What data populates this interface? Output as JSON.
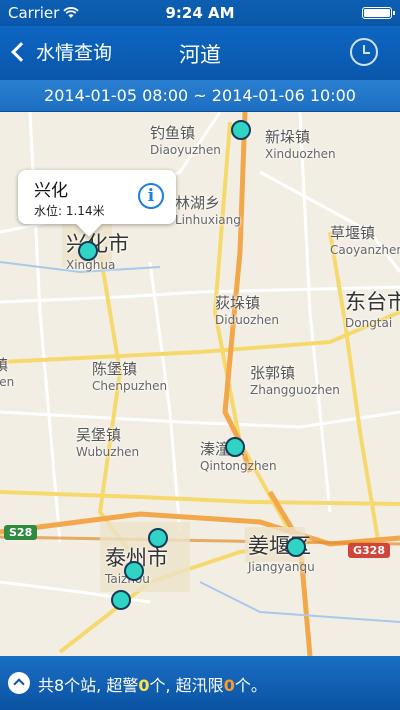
{
  "status_bar": {
    "carrier": "Carrier",
    "time": "9:24 AM",
    "icon_wifi": "wifi-icon",
    "icon_battery": "battery-icon"
  },
  "nav": {
    "back_label": "水情查询",
    "title": "河道",
    "history_icon": "clock-icon"
  },
  "date_range": "2014-01-05 08:00 ~ 2014-01-06 10:00",
  "callout": {
    "name": "兴化",
    "level": "水位: 1.14米",
    "info_icon": "info-icon"
  },
  "places": [
    {
      "cn": "钓鱼镇",
      "py": "Diaoyuzhen"
    },
    {
      "cn": "新垛镇",
      "py": "Xinduozhen"
    },
    {
      "cn": "林湖乡",
      "py": "Linhuxiang"
    },
    {
      "cn": "草堰镇",
      "py": "Caoyanzhen"
    },
    {
      "cn": "兴化市",
      "py": "Xinghua"
    },
    {
      "cn": "荻垛镇",
      "py": "Diduozhen"
    },
    {
      "cn": "东台市",
      "py": "Dongtai"
    },
    {
      "cn": "陈堡镇",
      "py": "Chenpuzhen"
    },
    {
      "cn": "张郭镇",
      "py": "Zhangguozhen"
    },
    {
      "cn": "吴堡镇",
      "py": "Wubuzhen"
    },
    {
      "cn": "溱潼镇",
      "py": "Qintongzhen"
    },
    {
      "cn": "泰州市",
      "py": "Taizhou"
    },
    {
      "cn": "姜堰区",
      "py": "Jiangyanqu"
    },
    {
      "cn": "垛镇",
      "py": "ozhen"
    }
  ],
  "road_shields": {
    "s28": "S28",
    "g328": "G328"
  },
  "bottom": {
    "prefix": "共8个站, 超警",
    "warn_count": "0",
    "middle": "个, 超汛限",
    "flood_count": "0",
    "suffix": "个。"
  },
  "colors": {
    "nav_blue": "#0957ab",
    "station": "#2fd4c4",
    "warn": "#ffe14a",
    "flood": "#ff9a2a"
  }
}
